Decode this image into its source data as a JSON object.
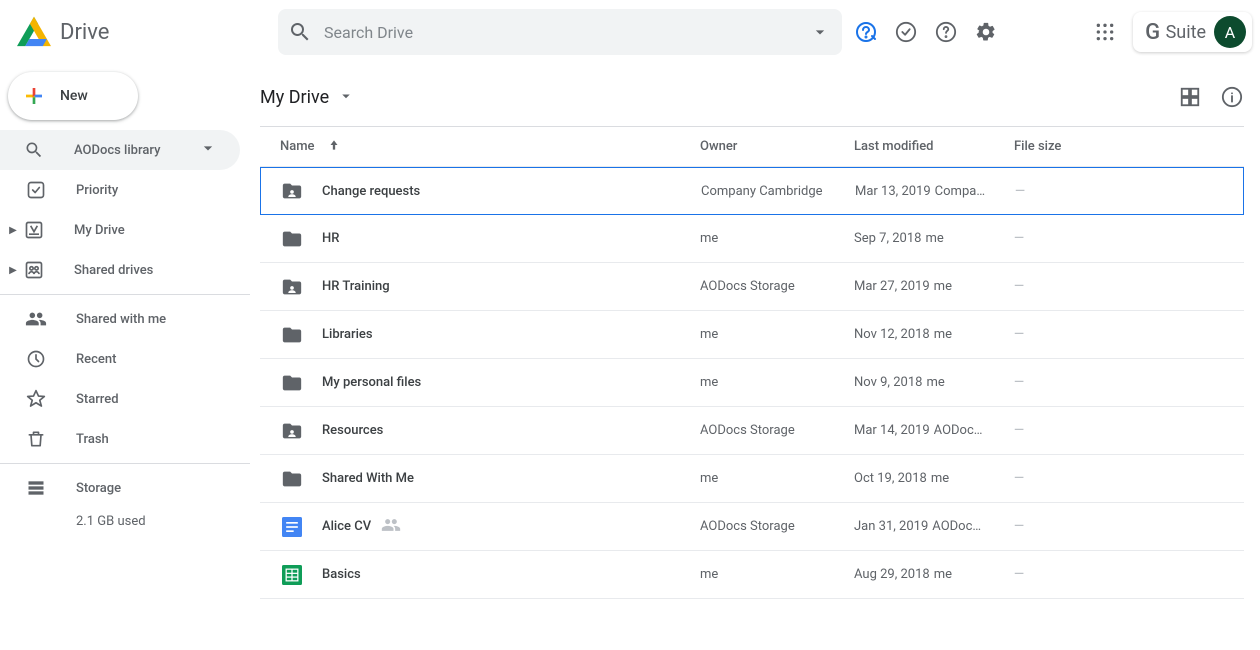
{
  "header": {
    "app_name": "Drive",
    "search_placeholder": "Search Drive",
    "gsuite_label": "Suite",
    "avatar_letter": "A"
  },
  "sidebar": {
    "new_button": "New",
    "aodocs_label": "AODocs library",
    "items": [
      {
        "id": "priority",
        "label": "Priority"
      },
      {
        "id": "mydrive",
        "label": "My Drive"
      },
      {
        "id": "shared-drives",
        "label": "Shared drives"
      },
      {
        "id": "shared-with-me",
        "label": "Shared with me"
      },
      {
        "id": "recent",
        "label": "Recent"
      },
      {
        "id": "starred",
        "label": "Starred"
      },
      {
        "id": "trash",
        "label": "Trash"
      },
      {
        "id": "storage",
        "label": "Storage"
      }
    ],
    "storage_used": "2.1 GB used"
  },
  "main": {
    "breadcrumb": "My Drive",
    "columns": {
      "name": "Name",
      "owner": "Owner",
      "modified": "Last modified",
      "size": "File size"
    },
    "rows": [
      {
        "type": "shared-folder",
        "name": "Change requests",
        "owner": "Company Cambridge",
        "modified": "Mar 13, 2019",
        "modified_by": "Compa…",
        "size": "—",
        "selected": true
      },
      {
        "type": "folder",
        "name": "HR",
        "owner": "me",
        "modified": "Sep 7, 2018",
        "modified_by": "me",
        "size": "—"
      },
      {
        "type": "shared-folder",
        "name": "HR Training",
        "owner": "AODocs Storage",
        "modified": "Mar 27, 2019",
        "modified_by": "me",
        "size": "—"
      },
      {
        "type": "folder",
        "name": "Libraries",
        "owner": "me",
        "modified": "Nov 12, 2018",
        "modified_by": "me",
        "size": "—"
      },
      {
        "type": "folder",
        "name": "My personal files",
        "owner": "me",
        "modified": "Nov 9, 2018",
        "modified_by": "me",
        "size": "—"
      },
      {
        "type": "shared-folder",
        "name": "Resources",
        "owner": "AODocs Storage",
        "modified": "Mar 14, 2019",
        "modified_by": "AODoc…",
        "size": "—"
      },
      {
        "type": "folder",
        "name": "Shared With Me",
        "owner": "me",
        "modified": "Oct 19, 2018",
        "modified_by": "me",
        "size": "—"
      },
      {
        "type": "doc",
        "name": "Alice CV",
        "owner": "AODocs Storage",
        "modified": "Jan 31, 2019",
        "modified_by": "AODoc…",
        "size": "—",
        "shared": true
      },
      {
        "type": "sheet",
        "name": "Basics",
        "owner": "me",
        "modified": "Aug 29, 2018",
        "modified_by": "me",
        "size": "—"
      }
    ]
  }
}
